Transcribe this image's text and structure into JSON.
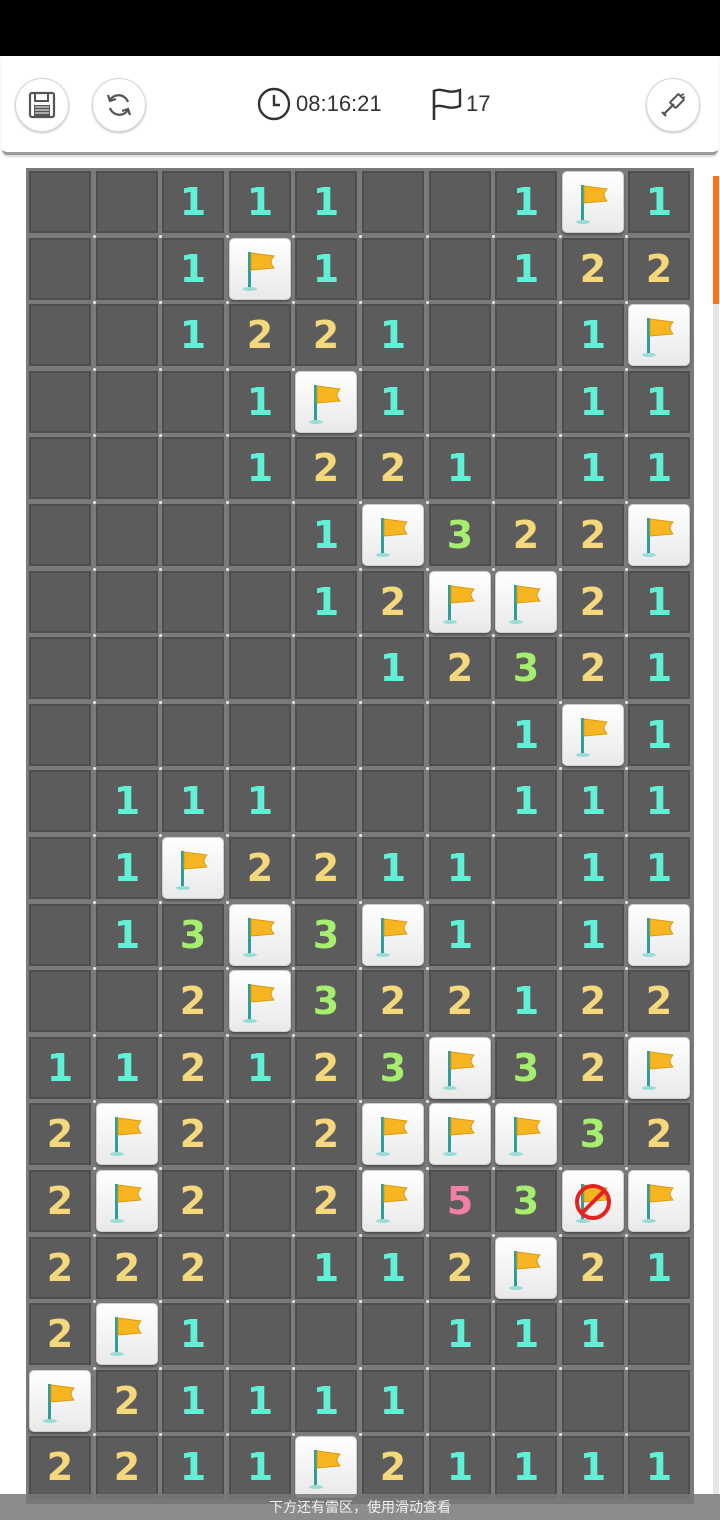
{
  "header": {
    "timer": "08:16:21",
    "flags_remaining": "17",
    "icons": {
      "save": "save-icon",
      "restart": "restart-icon",
      "clock": "clock-icon",
      "flag": "flag-icon",
      "shovel": "shovel-icon"
    }
  },
  "board": {
    "columns": 10,
    "rows": 20,
    "legend": "H = unopened, F = flagged, X = wrongly flagged, '' = opened empty, digit = neighbour count",
    "grid": [
      [
        "H",
        "H",
        "1",
        "1",
        "1",
        "",
        "",
        "1",
        "F",
        "1"
      ],
      [
        "H",
        "H",
        "1",
        "F",
        "1",
        "",
        "",
        "1",
        "2",
        "2"
      ],
      [
        "H",
        "H",
        "1",
        "2",
        "2",
        "1",
        "",
        "",
        "1",
        "F"
      ],
      [
        "H",
        "H",
        "",
        "1",
        "F",
        "1",
        "",
        "",
        "1",
        "1"
      ],
      [
        "H",
        "H",
        "",
        "1",
        "2",
        "2",
        "1",
        "",
        "1",
        "1"
      ],
      [
        "H",
        "H",
        "",
        "",
        "1",
        "F",
        "3",
        "2",
        "2",
        "F"
      ],
      [
        "H",
        "H",
        "",
        "",
        "1",
        "2",
        "F",
        "F",
        "2",
        "1"
      ],
      [
        "H",
        "H",
        "",
        "",
        "",
        "1",
        "2",
        "3",
        "2",
        "1"
      ],
      [
        "H",
        "H",
        "",
        "",
        "",
        "",
        "",
        "1",
        "F",
        "1"
      ],
      [
        "",
        "1",
        "1",
        "1",
        "",
        "",
        "",
        "1",
        "1",
        "1"
      ],
      [
        "",
        "1",
        "F",
        "2",
        "2",
        "1",
        "1",
        "",
        "1",
        "1"
      ],
      [
        "",
        "1",
        "3",
        "F",
        "3",
        "F",
        "1",
        "",
        "1",
        "F"
      ],
      [
        "",
        "",
        "2",
        "F",
        "3",
        "2",
        "2",
        "1",
        "2",
        "2"
      ],
      [
        "1",
        "1",
        "2",
        "1",
        "2",
        "3",
        "F",
        "3",
        "2",
        "F"
      ],
      [
        "2",
        "F",
        "2",
        "",
        "2",
        "F",
        "F",
        "F",
        "3",
        "2"
      ],
      [
        "2",
        "F",
        "2",
        "",
        "2",
        "F",
        "5",
        "3",
        "X",
        "F"
      ],
      [
        "2",
        "2",
        "2",
        "",
        "1",
        "1",
        "2",
        "F",
        "2",
        "1"
      ],
      [
        "2",
        "F",
        "1",
        "",
        "",
        "",
        "1",
        "1",
        "1",
        ""
      ],
      [
        "F",
        "2",
        "1",
        "1",
        "1",
        "1",
        "",
        "",
        "",
        ""
      ],
      [
        "2",
        "2",
        "1",
        "1",
        "F",
        "2",
        "1",
        "1",
        "1",
        "1"
      ]
    ],
    "number_colors": {
      "1": "#5ff0d6",
      "2": "#f5d77c",
      "3": "#a6ef6e",
      "5": "#f27fa5"
    }
  },
  "hint": "下方还有雷区，使用滑动查看",
  "colors": {
    "scroll_accent": "#ff6f1a",
    "flag_yellow": "#f7b521"
  }
}
